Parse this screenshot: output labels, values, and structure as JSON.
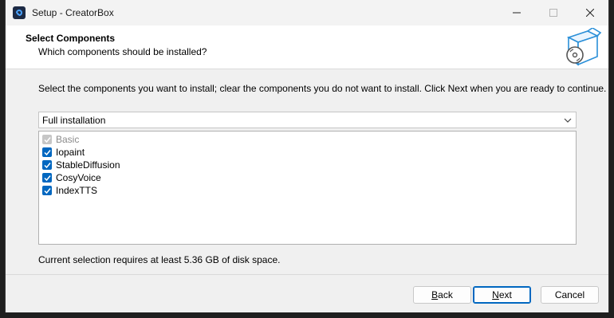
{
  "window": {
    "title": "Setup - CreatorBox"
  },
  "icons": {
    "app": "creatorbox-app-icon",
    "minimize": "minimize-icon",
    "maximize": "maximize-icon",
    "close": "close-icon",
    "header": "install-box-disc-icon",
    "dropdown": "chevron-down-icon",
    "check": "checkmark-icon"
  },
  "header": {
    "title": "Select Components",
    "subtitle": "Which components should be installed?"
  },
  "content": {
    "description": "Select the components you want to install; clear the components you do not want to install. Click Next when you are ready to continue.",
    "install_type": {
      "selected": "Full installation"
    },
    "components": [
      {
        "label": "Basic",
        "checked": true,
        "disabled": true
      },
      {
        "label": "Iopaint",
        "checked": true,
        "disabled": false
      },
      {
        "label": "StableDiffusion",
        "checked": true,
        "disabled": false
      },
      {
        "label": "CosyVoice",
        "checked": true,
        "disabled": false
      },
      {
        "label": "IndexTTS",
        "checked": true,
        "disabled": false
      }
    ],
    "disk_space": "Current selection requires at least 5.36 GB of disk space."
  },
  "buttons": {
    "back": {
      "underlined": "B",
      "rest": "ack"
    },
    "next": {
      "underlined": "N",
      "rest": "ext"
    },
    "cancel": "Cancel"
  },
  "colors": {
    "accent": "#0067c0",
    "disabled": "#c6c6c6"
  }
}
